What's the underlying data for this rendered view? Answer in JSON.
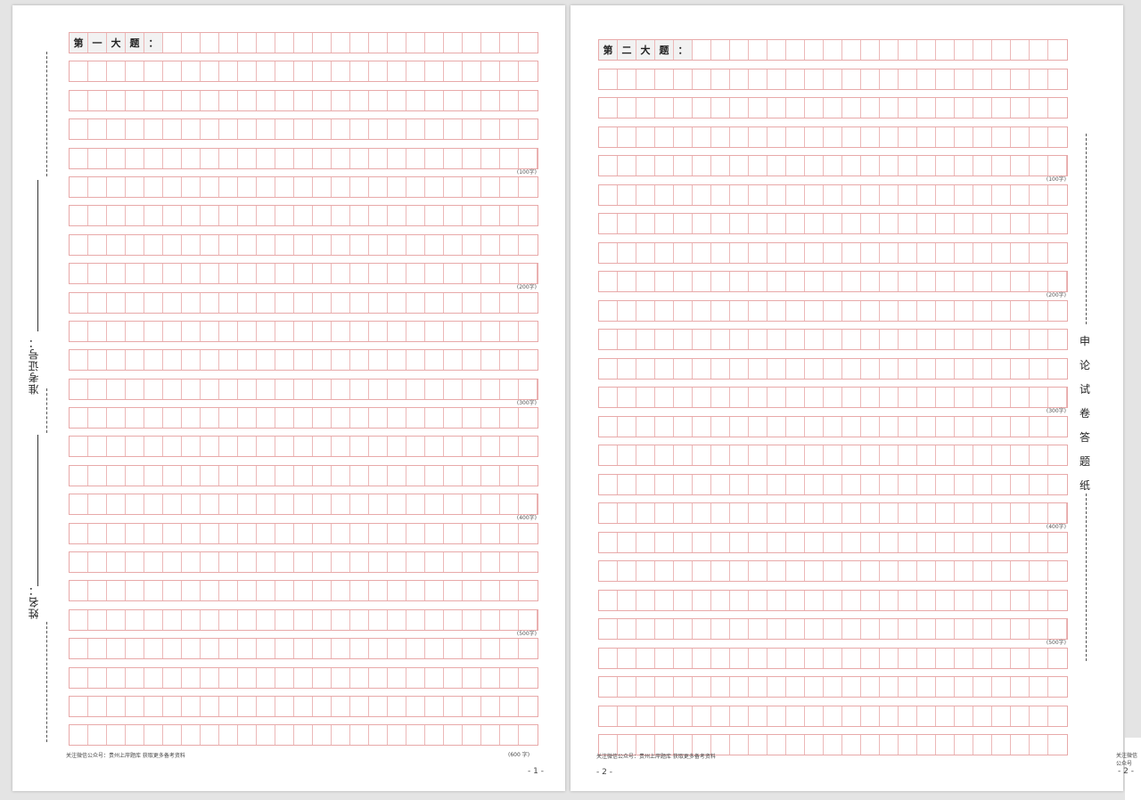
{
  "pages": [
    {
      "title_chars": [
        "第",
        "一",
        "大",
        "题",
        "："
      ],
      "row_count": 25,
      "cols": 25,
      "count_labels": {
        "4": "(100字)",
        "8": "(200字)",
        "12": "(300字)",
        "16": "(400字)",
        "20": "(500字)"
      },
      "margin": {
        "exam_id_label": "准考证号：",
        "name_label": "姓名："
      },
      "footer_note": "关注微信公众号：贵州上岸题库 获取更多备考资料",
      "footer_count": "(600 字)",
      "page_number": "- 1 -"
    },
    {
      "title_chars": [
        "第",
        "二",
        "大",
        "题",
        "："
      ],
      "row_count": 25,
      "cols": 25,
      "count_labels": {
        "4": "(100字)",
        "8": "(200字)",
        "12": "(300字)",
        "16": "(400字)",
        "20": "(500字)"
      },
      "side_title": [
        "申",
        "论",
        "试",
        "卷",
        "答",
        "题",
        "纸"
      ],
      "footer_note": "关注微信公众号：贵州上岸题库 获取更多备考资料",
      "page_number": "- 2 -"
    }
  ],
  "next_page": {
    "footer_note": "关注微信公众号",
    "page_number": "- 2 -"
  },
  "colors": {
    "grid": "#e8a9a9",
    "page": "#ffffff",
    "background": "#e4e4e4"
  }
}
